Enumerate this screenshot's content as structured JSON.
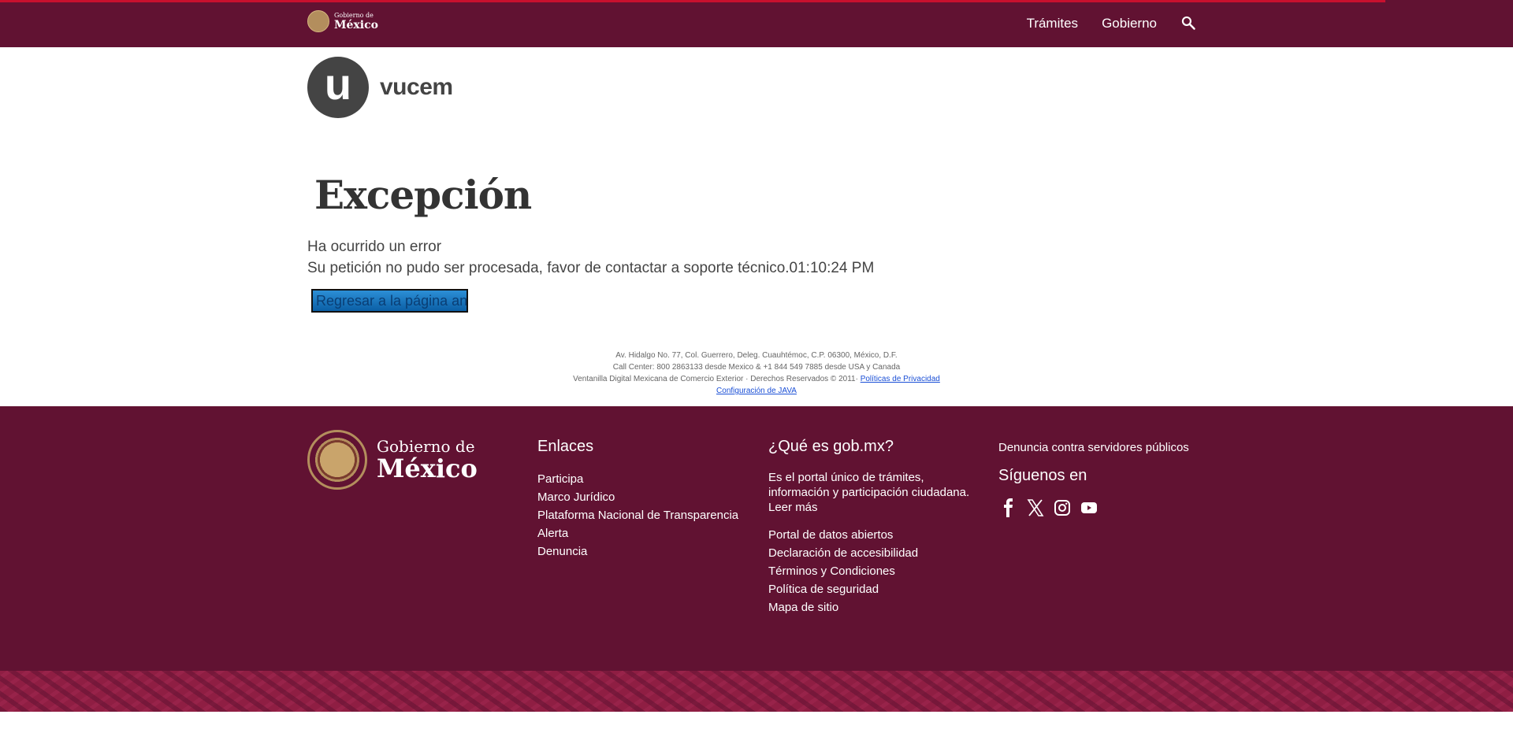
{
  "topbar": {
    "brand_line1": "Gobierno de",
    "brand_line2": "México",
    "nav": [
      "Trámites",
      "Gobierno"
    ]
  },
  "logo": {
    "initial": "u",
    "name": "vucem"
  },
  "content": {
    "title": "Excepción",
    "message1": "Ha ocurrido un error",
    "message2": "Su petición no pudo ser procesada, favor de contactar a soporte técnico.01:10:24 PM",
    "back_button": "Regresar a la página anterior"
  },
  "small_footer": {
    "address": "Av. Hidalgo No. 77, Col. Guerrero, Deleg. Cuauhtémoc, C.P. 06300, México, D.F.",
    "call_center": "Call Center: 800 2863133 desde Mexico & +1 844 549 7885 desde USA y Canada",
    "rights": "Ventanilla Digital Mexicana de Comercio Exterior · Derechos Reservados © 2011·",
    "privacy_link": "Políticas de Privacidad",
    "java_link": "Configuración de JAVA"
  },
  "footer": {
    "logo_line1": "Gobierno de",
    "logo_line2": "México",
    "enlaces_title": "Enlaces",
    "enlaces": [
      "Participa",
      "Marco Jurídico",
      "Plataforma Nacional de Transparencia",
      "Alerta",
      "Denuncia"
    ],
    "que_es_title": "¿Qué es gob.mx?",
    "que_es_text": "Es el portal único de trámites, información y participación ciudadana.",
    "leer_mas": "Leer más",
    "que_es_links": [
      "Portal de datos abiertos",
      "Declaración de accesibilidad",
      "Términos y Condiciones",
      "Política de seguridad",
      "Mapa de sitio"
    ],
    "denuncia": "Denuncia contra servidores públicos",
    "siguenos_title": "Síguenos en",
    "social_icons": [
      "facebook-icon",
      "x-icon",
      "instagram-icon",
      "youtube-icon"
    ]
  },
  "colors": {
    "brand": "#611232",
    "accent": "#c8102e",
    "gold": "#b38e5d"
  }
}
